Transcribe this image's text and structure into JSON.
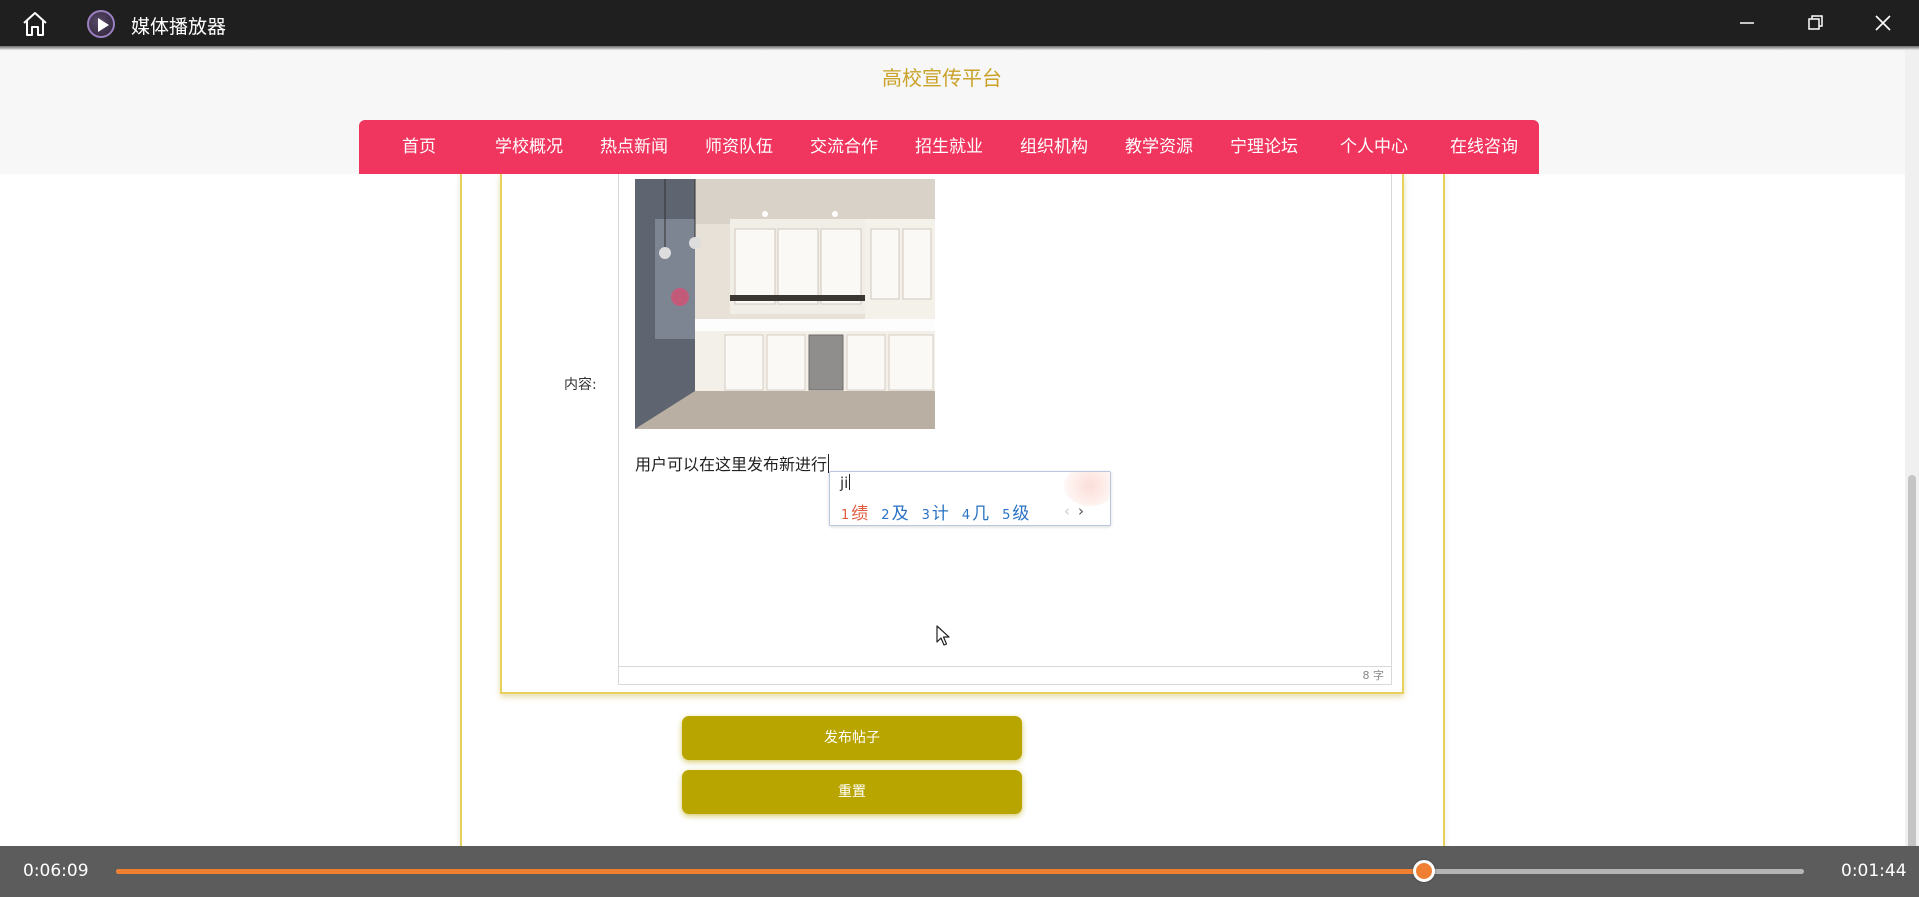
{
  "window": {
    "title": "媒体播放器"
  },
  "site": {
    "title": "高校宣传平台",
    "nav": [
      "首页",
      "学校概况",
      "热点新闻",
      "师资队伍",
      "交流合作",
      "招生就业",
      "组织机构",
      "教学资源",
      "宁理论坛",
      "个人中心",
      "在线咨询"
    ]
  },
  "form": {
    "content_label": "内容:",
    "editor_text": "用户可以在这里发布新进行",
    "word_count": "8 字",
    "publish_label": "发布帖子",
    "reset_label": "重置"
  },
  "ime": {
    "pinyin": "ji",
    "candidates": [
      {
        "num": "1",
        "char": "绩"
      },
      {
        "num": "2",
        "char": "及"
      },
      {
        "num": "3",
        "char": "计"
      },
      {
        "num": "4",
        "char": "几"
      },
      {
        "num": "5",
        "char": "级"
      }
    ],
    "prev": "‹",
    "next": "›"
  },
  "player": {
    "current_time": "0:06:09",
    "total_time": "0:01:44",
    "progress": 0.775
  },
  "colors": {
    "nav_bg": "#f0365f",
    "site_title": "#c9a227",
    "button_bg": "#b9a500",
    "progress": "#f07f32"
  },
  "icons": [
    "home-icon",
    "app-logo-icon",
    "minimize-icon",
    "restore-icon",
    "close-icon",
    "mouse-cursor-icon"
  ]
}
